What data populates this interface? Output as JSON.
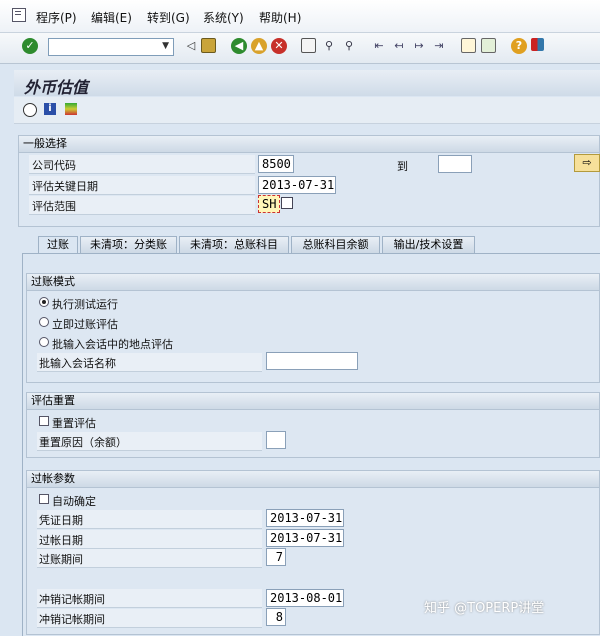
{
  "menu": {
    "items": [
      "程序(P)",
      "编辑(E)",
      "转到(G)",
      "系统(Y)",
      "帮助(H)"
    ]
  },
  "toolbar": {
    "command_value": "",
    "icons": [
      "ok-icon",
      "back-icon",
      "save-icon",
      "nav-back-icon",
      "nav-exit-icon",
      "cancel-icon",
      "print-icon",
      "find-icon",
      "find-next-icon",
      "first-page-icon",
      "prev-page-icon",
      "next-page-icon",
      "last-page-icon",
      "new-session-icon",
      "shortcut-icon",
      "help-icon",
      "layout-icon"
    ]
  },
  "title": "外币估值",
  "general": {
    "header": "一般选择",
    "company_label": "公司代码",
    "company_value": "8500",
    "to_label": "到",
    "to_value": "",
    "keydate_label": "评估关键日期",
    "keydate_value": "2013-07-31",
    "area_label": "评估范围",
    "area_value": "SH"
  },
  "tabs": [
    "过账",
    "未清项：分类账",
    "未清项：总账科目",
    "总账科目余额",
    "输出/技术设置"
  ],
  "posting_mode": {
    "header": "过账模式",
    "options": [
      "执行测试运行",
      "立即过账评估",
      "批输入会话中的地点评估"
    ],
    "selected": 0,
    "session_label": "批输入会话名称",
    "session_value": ""
  },
  "reset": {
    "header": "评估重置",
    "reset_label": "重置评估",
    "reason_label": "重置原因（余额）",
    "reason_value": ""
  },
  "params": {
    "header": "过帐参数",
    "auto_label": "自动确定",
    "doc_date_label": "凭证日期",
    "doc_date_value": "2013-07-31",
    "post_date_label": "过帐日期",
    "post_date_value": "2013-07-31",
    "period_label": "过账期间",
    "period_value": "7",
    "rev_date_label": "冲销记帐期间",
    "rev_date_value": "2013-08-01",
    "rev_period_label": "冲销记帐期间",
    "rev_period_value": "8"
  },
  "watermark": "知乎 @TOPERP讲堂"
}
